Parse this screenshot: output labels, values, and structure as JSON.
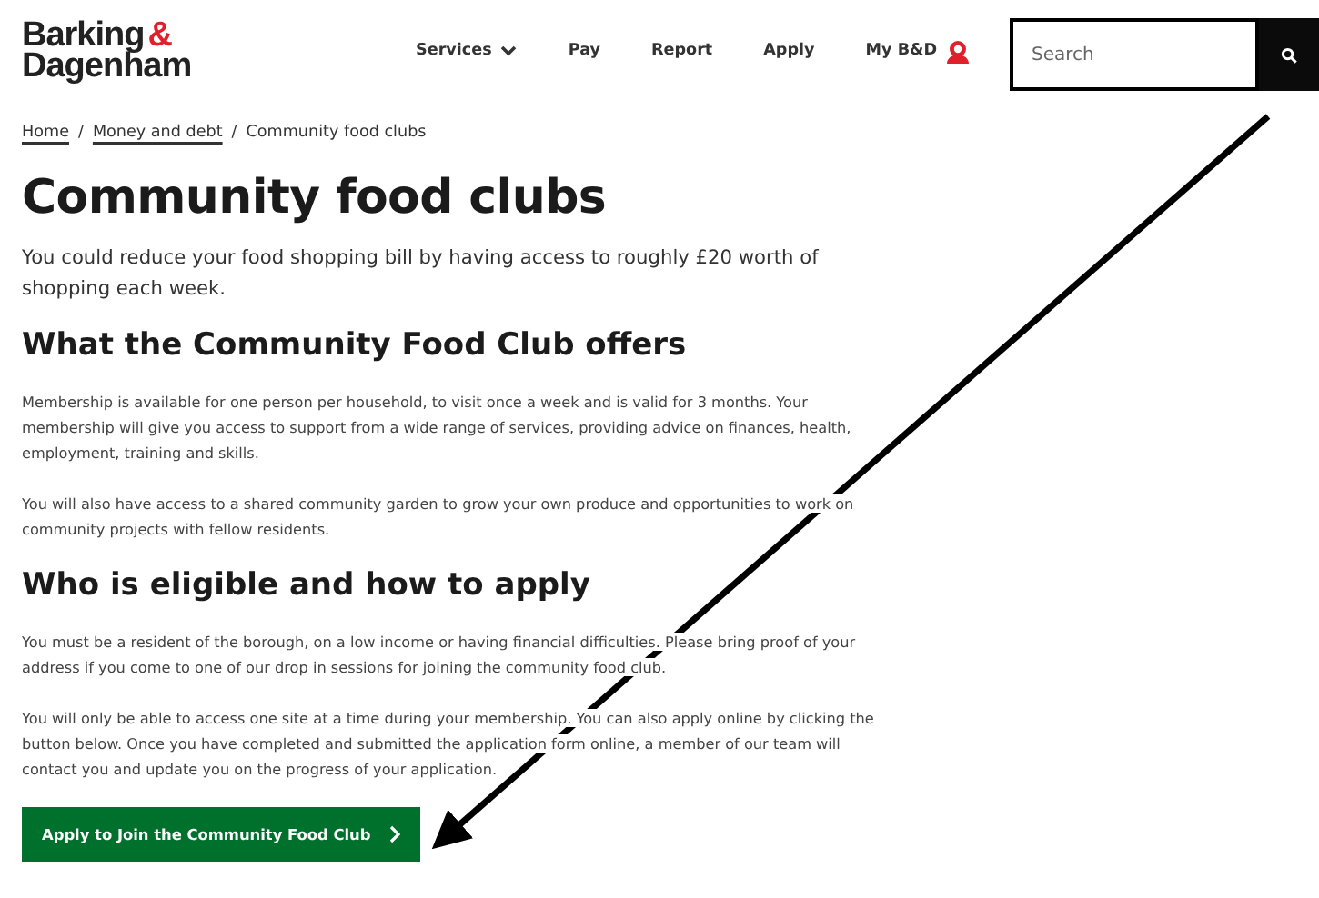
{
  "header": {
    "logo": {
      "line_1": "Barking",
      "ampersand": "&",
      "line_2": "Dagenham"
    },
    "nav": [
      {
        "label": "Services",
        "kind": "dropdown"
      },
      {
        "label": "Pay",
        "kind": "link"
      },
      {
        "label": "Report",
        "kind": "link"
      },
      {
        "label": "Apply",
        "kind": "link"
      },
      {
        "label": "My B&D",
        "kind": "account"
      }
    ],
    "search": {
      "placeholder": "Search"
    }
  },
  "breadcrumb": [
    {
      "label": "Home",
      "link": true
    },
    {
      "label": "Money and debt",
      "link": true
    },
    {
      "label": "Community food clubs",
      "link": false
    }
  ],
  "breadcrumb_separator": "/",
  "title": "Community food clubs",
  "intro": "You could reduce your food shopping bill by having access to roughly £20 worth of shopping each week.",
  "sections": [
    {
      "heading": "What the Community Food Club offers",
      "paragraphs": [
        "Membership is available for one person per household, to visit once a week and is valid for 3 months. Your membership will give you access to support from a wide range of services, providing advice on finances, health, employment, training and skills.",
        "You will also have access to a shared community garden to grow your own produce and opportunities to work on community projects with fellow residents."
      ]
    },
    {
      "heading": "Who is eligible and how to apply",
      "paragraphs": [
        "You must be a resident of the borough, on a low income or having financial difficulties. Please bring proof of your address if you come to one of our drop in sessions for joining the community food club.",
        "You will only be able to access one site at a time during your membership. You can also apply online by clicking the button below. Once you have completed and submitted the application form online, a member of our team will contact you and update you on the progress of your application."
      ]
    }
  ],
  "apply_button": {
    "label": "Apply to Join the Community Food Club"
  }
}
